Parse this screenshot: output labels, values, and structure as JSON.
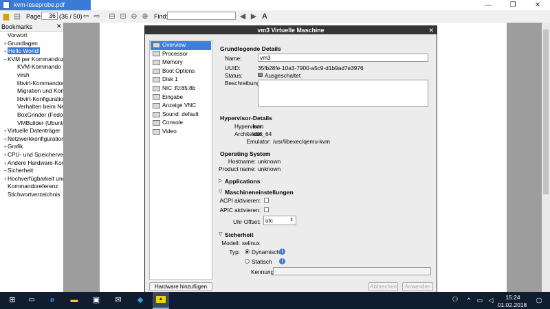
{
  "window": {
    "tab_title": "kvm-leseprobe.pdf",
    "min_glyph": "—",
    "max_glyph": "❐",
    "close_glyph": "✕"
  },
  "toolbar": {
    "page_label": "Page:",
    "page_value": "36",
    "page_count": "(36 / 50)",
    "find_label": "Find:",
    "find_value": ""
  },
  "bookmarks": {
    "title": "Bookmarks",
    "close_glyph": "✕",
    "items": [
      {
        "label": "Vorwort",
        "exp": ""
      },
      {
        "label": "Grundlagen",
        "exp": "+"
      },
      {
        "label": "Hello World!",
        "exp": "+"
      },
      {
        "label": "KVM per Kommandozeil",
        "exp": "−"
      },
      {
        "label": "KVM-Kommando",
        "exp": ""
      },
      {
        "label": "virsh",
        "exp": ""
      },
      {
        "label": "libvirt-Kommandos",
        "exp": ""
      },
      {
        "label": "Migration und Konver",
        "exp": ""
      },
      {
        "label": "libvirt-Konfiguration u",
        "exp": ""
      },
      {
        "label": "Verhalten beim Neusta",
        "exp": ""
      },
      {
        "label": "BoxGrinder (Fedora, R",
        "exp": ""
      },
      {
        "label": "VMBuilder (Ubuntu)",
        "exp": ""
      },
      {
        "label": "Virtuelle Datenträger",
        "exp": "+"
      },
      {
        "label": "Netzwerkkonfiguration",
        "exp": "+"
      },
      {
        "label": "Grafik",
        "exp": "+"
      },
      {
        "label": "CPU- und Speicherverwa",
        "exp": "+"
      },
      {
        "label": "Andere Hardware-Komp",
        "exp": "+"
      },
      {
        "label": "Sicherheit",
        "exp": "+"
      },
      {
        "label": "Hochverfügbarkeit und (",
        "exp": "+"
      },
      {
        "label": "Kommandoreferenz",
        "exp": ""
      },
      {
        "label": "Stichwortverzeichnis",
        "exp": ""
      }
    ]
  },
  "dialog": {
    "title": "vm3 Virtuelle Maschine",
    "close_glyph": "✕",
    "nav": [
      "Overview",
      "Processor",
      "Memory",
      "Boot Options",
      "Disk 1",
      "NIC :f0:85:8b",
      "Eingabe",
      "Anzeige VNC",
      "Sound: default",
      "Console",
      "Video"
    ],
    "add_hw_button": "Hardware hinzufügen",
    "apply_button": "Abbrechen",
    "apply2_button": "Anwenden",
    "basic": {
      "heading": "Grundlegende Details",
      "name_label": "Name:",
      "name_value": "vm3",
      "uuid_label": "UUID:",
      "uuid_value": "35fb28fe-10a3-7900-a5c9-d1b9ad7e3976",
      "status_label": "Status:",
      "status_value": "Ausgeschaltet",
      "desc_label": "Beschreibung:"
    },
    "hypervisor": {
      "heading": "Hypervisor-Details",
      "hv_label": "Hypervisor:",
      "hv_value": "kvm",
      "arch_label": "Architektur:",
      "arch_value": "x86_64",
      "emu_label": "Emulator:",
      "emu_value": "/usr/libexec/qemu-kvm"
    },
    "os": {
      "heading": "Operating System",
      "host_label": "Hostname:",
      "host_value": "unknown",
      "prod_label": "Product name:",
      "prod_value": "unknown"
    },
    "apps": {
      "heading": "Applications"
    },
    "machine": {
      "heading": "Maschineneinstellungen",
      "acpi_label": "ACPI aktivieren:",
      "apic_label": "APIC aktivieren:",
      "clock_label": "Uhr Offset:",
      "clock_value": "utc"
    },
    "security": {
      "heading": "Sicherheit",
      "model_label": "Modell:",
      "model_value": "selinux",
      "type_label": "Typ:",
      "dynamic_label": "Dynamisch",
      "static_label": "Statisch",
      "label_label": "Kennung"
    }
  },
  "taskbar": {
    "time": "15:24",
    "date": "01.02.2018"
  }
}
